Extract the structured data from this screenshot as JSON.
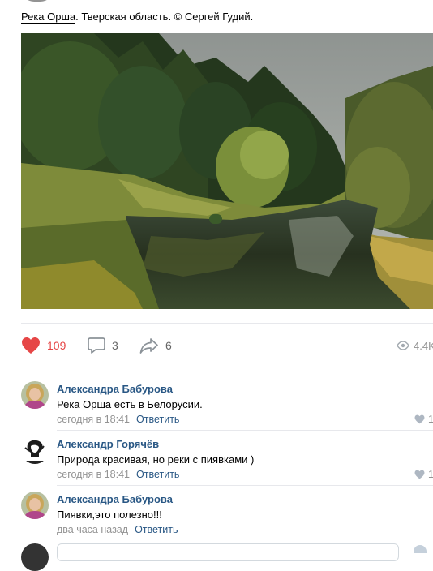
{
  "post": {
    "caption_place": "Река Орша",
    "caption_rest": ". Тверская область. © Сергей Гудий."
  },
  "actions": {
    "likes": "109",
    "comments": "3",
    "shares": "6",
    "views": "4.4K"
  },
  "comments": [
    {
      "author": "Александра Бабурова",
      "text": "Река Орша есть в Белорусии.",
      "time": "сегодня в 18:41",
      "reply_label": "Ответить",
      "likes": "1"
    },
    {
      "author": "Александр Горячёв",
      "text": "Природа красивая, но реки с пиявками )",
      "time": "сегодня в 18:41",
      "reply_label": "Ответить",
      "likes": "1"
    },
    {
      "author": "Александра Бабурова",
      "text": "Пиявки,это полезно!!!",
      "time": "два часа назад",
      "reply_label": "Ответить"
    }
  ],
  "colors": {
    "like_red": "#e64646",
    "link_blue": "#2a5885",
    "muted_gray": "#939393"
  },
  "icons": [
    "heart-icon",
    "comment-icon",
    "share-icon",
    "eye-icon",
    "small-heart-icon"
  ]
}
